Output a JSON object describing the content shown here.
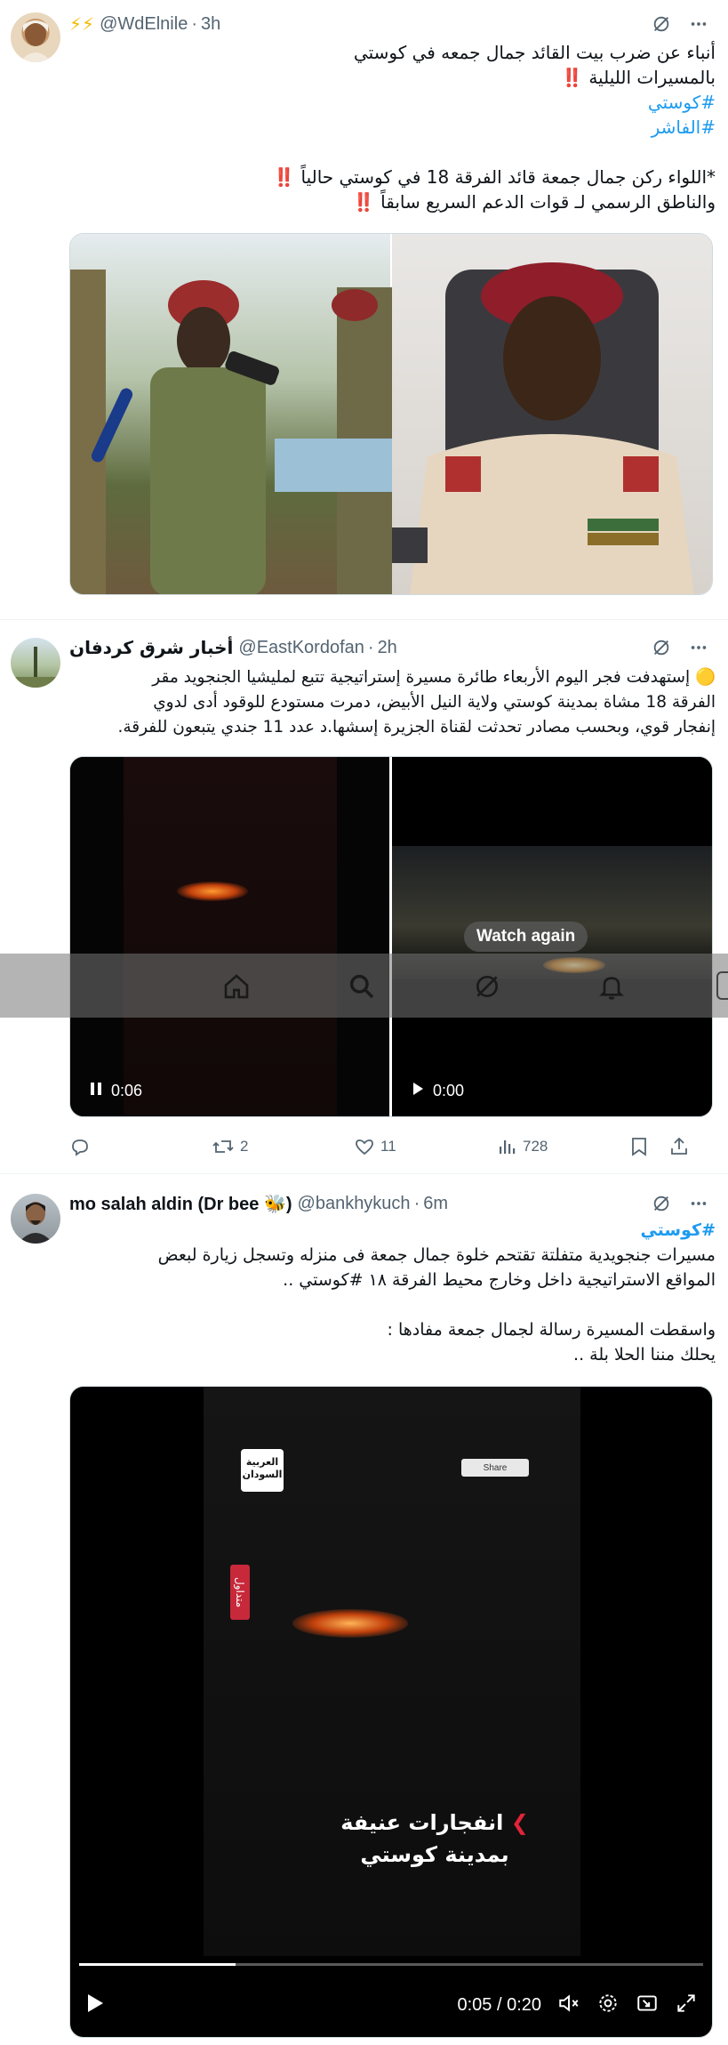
{
  "tweets": [
    {
      "name": "⚡⚡",
      "handle": "@WdElnile",
      "time": "3h",
      "lines": [
        "أنباء عن ضرب بيت القائد جمال جمعه في كوستي",
        "بالمسيرات الليلية ‼️",
        "#كوستي",
        "#الفاشر",
        "",
        "*اللواء ركن جمال جمعة قائد الفرقة 18 في كوستي حالياً ‼️",
        "والناطق الرسمي لـ قوات الدعم السريع سابقاً ‼️"
      ]
    },
    {
      "name": "أخبار شرق كردفان",
      "handle": "@EastKordofan",
      "time": "2h",
      "lines": [
        "🟡 إستهدفت فجر اليوم الأربعاء طائرة مسيرة إستراتيجية تتبع لمليشيا الجنجويد مقر",
        "الفرقة 18 مشاة بمدينة كوستي ولاية النيل الأبيض، دمرت مستودع للوقود أدى لدوي",
        "إنفجار قوي، وبحسب مصادر تحدثت لقناة الجزيرة إسشها.د عدد 11 جندي يتبعون للفرقة."
      ],
      "video_left_time": "0:06",
      "video_right_time": "0:00",
      "watch_again": "Watch again",
      "replies": "",
      "retweets": "2",
      "likes": "11",
      "views": "728"
    },
    {
      "name": "mo salah aldin (Dr bee 🐝)",
      "handle": "@bankhykuch",
      "time": "6m",
      "lines": [
        "#كوستي",
        "مسيرات جنجويدية متفلتة تقتحم خلوة جمال جمعة فى منزله وتسجل زيارة لبعض",
        "المواقع الاستراتيجية داخل وخارج محيط الفرقة ١٨ #كوستي ..",
        "",
        "واسقطت المسيرة رسالة لجمال جمعة مفادها :",
        "يحلك مننا الحلا بلة .."
      ],
      "channel_logo": "العربية السودان",
      "side_tag": "متداول",
      "share_label": "Share",
      "caption_line1": "انفجارات عنيفة",
      "caption_line2": "بمدينة كوستي",
      "video_time": "0:05 / 0:20",
      "progress": 0.25
    }
  ],
  "icons": [
    "grok-icon",
    "more-icon",
    "reply-icon",
    "retweet-icon",
    "like-icon",
    "views-icon",
    "bookmark-icon",
    "share-icon",
    "home-icon",
    "search-icon",
    "notifications-icon",
    "play-icon",
    "pause-icon",
    "mute-icon",
    "settings-icon",
    "fullscreen-icon"
  ],
  "colors": {
    "accent": "#1d9bf0",
    "text": "#0f1419",
    "muted": "#536471"
  }
}
